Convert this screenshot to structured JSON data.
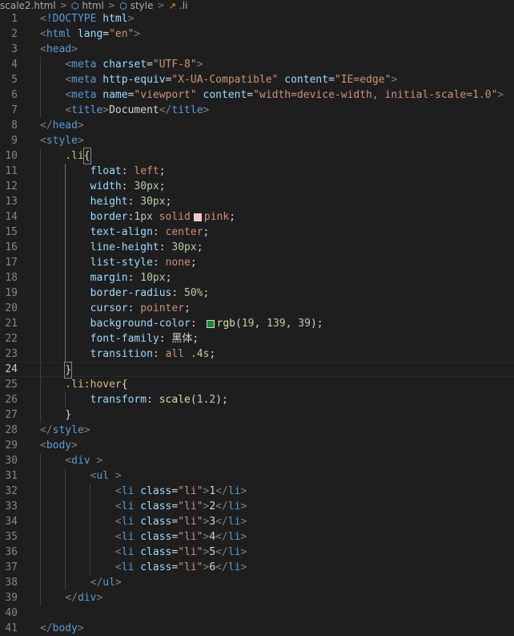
{
  "breadcrumb": {
    "file": "scale2.html",
    "items": [
      "html",
      "style",
      ".li"
    ],
    "icons": [
      "html-file-icon",
      "cube-element-icon",
      "cube-element-icon",
      "selector-symbol-icon"
    ]
  },
  "colors": {
    "background": "#1e1e1e",
    "tag": "#569cd6",
    "attribute": "#9cdcfe",
    "string": "#ce9178",
    "selector": "#d7ba7d",
    "number": "#b5cea8",
    "pink_swatch": "#ffc0cb",
    "green_swatch": "#138b27"
  },
  "editor": {
    "current_line": 24,
    "lines": [
      {
        "n": "1",
        "parts": [
          [
            "br",
            "<"
          ],
          [
            "tag",
            "!DOCTYPE"
          ],
          [
            "txt",
            " "
          ],
          [
            "attr",
            "html"
          ],
          [
            "br",
            ">"
          ]
        ]
      },
      {
        "n": "2",
        "parts": [
          [
            "br",
            "<"
          ],
          [
            "tag",
            "html"
          ],
          [
            "txt",
            " "
          ],
          [
            "attr",
            "lang"
          ],
          [
            "txt",
            "="
          ],
          [
            "str",
            "\"en\""
          ],
          [
            "br",
            ">"
          ]
        ]
      },
      {
        "n": "3",
        "parts": [
          [
            "br",
            "<"
          ],
          [
            "tag",
            "head"
          ],
          [
            "br",
            ">"
          ]
        ]
      },
      {
        "n": "4",
        "parts": [
          [
            "txt",
            "    "
          ],
          [
            "br",
            "<"
          ],
          [
            "tag",
            "meta"
          ],
          [
            "txt",
            " "
          ],
          [
            "attr",
            "charset"
          ],
          [
            "txt",
            "="
          ],
          [
            "str",
            "\"UTF-8\""
          ],
          [
            "br",
            ">"
          ]
        ]
      },
      {
        "n": "5",
        "parts": [
          [
            "txt",
            "    "
          ],
          [
            "br",
            "<"
          ],
          [
            "tag",
            "meta"
          ],
          [
            "txt",
            " "
          ],
          [
            "attr",
            "http-equiv"
          ],
          [
            "txt",
            "="
          ],
          [
            "str",
            "\"X-UA-Compatible\""
          ],
          [
            "txt",
            " "
          ],
          [
            "attr",
            "content"
          ],
          [
            "txt",
            "="
          ],
          [
            "str",
            "\"IE=edge\""
          ],
          [
            "br",
            ">"
          ]
        ]
      },
      {
        "n": "6",
        "parts": [
          [
            "txt",
            "    "
          ],
          [
            "br",
            "<"
          ],
          [
            "tag",
            "meta"
          ],
          [
            "txt",
            " "
          ],
          [
            "attr",
            "name"
          ],
          [
            "txt",
            "="
          ],
          [
            "str",
            "\"viewport\""
          ],
          [
            "txt",
            " "
          ],
          [
            "attr",
            "content"
          ],
          [
            "txt",
            "="
          ],
          [
            "str",
            "\"width=device-width, initial-scale=1.0\""
          ],
          [
            "br",
            ">"
          ]
        ]
      },
      {
        "n": "7",
        "parts": [
          [
            "txt",
            "    "
          ],
          [
            "br",
            "<"
          ],
          [
            "tag",
            "title"
          ],
          [
            "br",
            ">"
          ],
          [
            "txt",
            "Document"
          ],
          [
            "br",
            "</"
          ],
          [
            "tag",
            "title"
          ],
          [
            "br",
            ">"
          ]
        ]
      },
      {
        "n": "8",
        "parts": [
          [
            "br",
            "</"
          ],
          [
            "tag",
            "head"
          ],
          [
            "br",
            ">"
          ]
        ]
      },
      {
        "n": "9",
        "parts": [
          [
            "br",
            "<"
          ],
          [
            "tag",
            "style"
          ],
          [
            "br",
            ">"
          ]
        ]
      },
      {
        "n": "10",
        "parts": [
          [
            "txt",
            "    "
          ],
          [
            "sel",
            ".li"
          ],
          [
            "bracket",
            "{"
          ]
        ]
      },
      {
        "n": "11",
        "parts": [
          [
            "txt",
            "        "
          ],
          [
            "prop",
            "float"
          ],
          [
            "txt",
            ": "
          ],
          [
            "val",
            "left"
          ],
          [
            "txt",
            ";"
          ]
        ]
      },
      {
        "n": "12",
        "parts": [
          [
            "txt",
            "        "
          ],
          [
            "prop",
            "width"
          ],
          [
            "txt",
            ": "
          ],
          [
            "num",
            "30px"
          ],
          [
            "txt",
            ";"
          ]
        ]
      },
      {
        "n": "13",
        "parts": [
          [
            "txt",
            "        "
          ],
          [
            "prop",
            "height"
          ],
          [
            "txt",
            ": "
          ],
          [
            "num",
            "30px"
          ],
          [
            "txt",
            ";"
          ]
        ]
      },
      {
        "n": "14",
        "parts": [
          [
            "txt",
            "        "
          ],
          [
            "prop",
            "border"
          ],
          [
            "txt",
            ":"
          ],
          [
            "num",
            "1px"
          ],
          [
            "txt",
            " "
          ],
          [
            "val",
            "solid"
          ],
          [
            "swatch",
            "#ffc0cb"
          ],
          [
            "val",
            "pink"
          ],
          [
            "txt",
            ";"
          ]
        ]
      },
      {
        "n": "15",
        "parts": [
          [
            "txt",
            "        "
          ],
          [
            "prop",
            "text-align"
          ],
          [
            "txt",
            ": "
          ],
          [
            "val",
            "center"
          ],
          [
            "txt",
            ";"
          ]
        ]
      },
      {
        "n": "16",
        "parts": [
          [
            "txt",
            "        "
          ],
          [
            "prop",
            "line-height"
          ],
          [
            "txt",
            ": "
          ],
          [
            "num",
            "30px"
          ],
          [
            "txt",
            ";"
          ]
        ]
      },
      {
        "n": "17",
        "parts": [
          [
            "txt",
            "        "
          ],
          [
            "prop",
            "list-style"
          ],
          [
            "txt",
            ": "
          ],
          [
            "val",
            "none"
          ],
          [
            "txt",
            ";"
          ]
        ]
      },
      {
        "n": "18",
        "parts": [
          [
            "txt",
            "        "
          ],
          [
            "prop",
            "margin"
          ],
          [
            "txt",
            ": "
          ],
          [
            "num",
            "10px"
          ],
          [
            "txt",
            ";"
          ]
        ]
      },
      {
        "n": "19",
        "parts": [
          [
            "txt",
            "        "
          ],
          [
            "prop",
            "border-radius"
          ],
          [
            "txt",
            ": "
          ],
          [
            "num",
            "50%"
          ],
          [
            "txt",
            ";"
          ]
        ]
      },
      {
        "n": "20",
        "parts": [
          [
            "txt",
            "        "
          ],
          [
            "prop",
            "cursor"
          ],
          [
            "txt",
            ": "
          ],
          [
            "val",
            "pointer"
          ],
          [
            "txt",
            ";"
          ]
        ]
      },
      {
        "n": "21",
        "parts": [
          [
            "txt",
            "        "
          ],
          [
            "prop",
            "background-color"
          ],
          [
            "txt",
            ": "
          ],
          [
            "swatch",
            "#138b27"
          ],
          [
            "fn",
            "rgb"
          ],
          [
            "txt",
            "("
          ],
          [
            "num",
            "19"
          ],
          [
            "txt",
            ", "
          ],
          [
            "num",
            "139"
          ],
          [
            "txt",
            ", "
          ],
          [
            "num",
            "39"
          ],
          [
            "txt",
            ");"
          ]
        ]
      },
      {
        "n": "22",
        "parts": [
          [
            "txt",
            "        "
          ],
          [
            "prop",
            "font-family"
          ],
          [
            "txt",
            ": "
          ],
          [
            "txt",
            "黑体"
          ],
          [
            "txt",
            ";"
          ]
        ]
      },
      {
        "n": "23",
        "parts": [
          [
            "txt",
            "        "
          ],
          [
            "prop",
            "transition"
          ],
          [
            "txt",
            ": "
          ],
          [
            "val",
            "all"
          ],
          [
            "txt",
            " "
          ],
          [
            "num",
            ".4s"
          ],
          [
            "txt",
            ";"
          ]
        ]
      },
      {
        "n": "24",
        "parts": [
          [
            "txt",
            "    "
          ],
          [
            "bracket",
            "}"
          ]
        ]
      },
      {
        "n": "25",
        "parts": [
          [
            "txt",
            "    "
          ],
          [
            "sel",
            ".li:hover"
          ],
          [
            "txt",
            "{"
          ]
        ]
      },
      {
        "n": "26",
        "parts": [
          [
            "txt",
            "        "
          ],
          [
            "prop",
            "transform"
          ],
          [
            "txt",
            ": "
          ],
          [
            "fn",
            "scale"
          ],
          [
            "txt",
            "("
          ],
          [
            "num",
            "1.2"
          ],
          [
            "txt",
            ");"
          ]
        ]
      },
      {
        "n": "27",
        "parts": [
          [
            "txt",
            "    "
          ],
          [
            "txt",
            "}"
          ]
        ]
      },
      {
        "n": "28",
        "parts": [
          [
            "br",
            "</"
          ],
          [
            "tag",
            "style"
          ],
          [
            "br",
            ">"
          ]
        ]
      },
      {
        "n": "29",
        "parts": [
          [
            "br",
            "<"
          ],
          [
            "tag",
            "body"
          ],
          [
            "br",
            ">"
          ]
        ]
      },
      {
        "n": "30",
        "parts": [
          [
            "txt",
            "    "
          ],
          [
            "br",
            "<"
          ],
          [
            "tag",
            "div"
          ],
          [
            "txt",
            " "
          ],
          [
            "br",
            ">"
          ]
        ]
      },
      {
        "n": "31",
        "parts": [
          [
            "txt",
            "        "
          ],
          [
            "br",
            "<"
          ],
          [
            "tag",
            "ul"
          ],
          [
            "txt",
            " "
          ],
          [
            "br",
            ">"
          ]
        ]
      },
      {
        "n": "32",
        "parts": [
          [
            "txt",
            "            "
          ],
          [
            "br",
            "<"
          ],
          [
            "tag",
            "li"
          ],
          [
            "txt",
            " "
          ],
          [
            "attr",
            "class"
          ],
          [
            "txt",
            "="
          ],
          [
            "str",
            "\"li\""
          ],
          [
            "br",
            ">"
          ],
          [
            "txt",
            "1"
          ],
          [
            "br",
            "</"
          ],
          [
            "tag",
            "li"
          ],
          [
            "br",
            ">"
          ]
        ]
      },
      {
        "n": "33",
        "parts": [
          [
            "txt",
            "            "
          ],
          [
            "br",
            "<"
          ],
          [
            "tag",
            "li"
          ],
          [
            "txt",
            " "
          ],
          [
            "attr",
            "class"
          ],
          [
            "txt",
            "="
          ],
          [
            "str",
            "\"li\""
          ],
          [
            "br",
            ">"
          ],
          [
            "txt",
            "2"
          ],
          [
            "br",
            "</"
          ],
          [
            "tag",
            "li"
          ],
          [
            "br",
            ">"
          ]
        ]
      },
      {
        "n": "34",
        "parts": [
          [
            "txt",
            "            "
          ],
          [
            "br",
            "<"
          ],
          [
            "tag",
            "li"
          ],
          [
            "txt",
            " "
          ],
          [
            "attr",
            "class"
          ],
          [
            "txt",
            "="
          ],
          [
            "str",
            "\"li\""
          ],
          [
            "br",
            ">"
          ],
          [
            "txt",
            "3"
          ],
          [
            "br",
            "</"
          ],
          [
            "tag",
            "li"
          ],
          [
            "br",
            ">"
          ]
        ]
      },
      {
        "n": "35",
        "parts": [
          [
            "txt",
            "            "
          ],
          [
            "br",
            "<"
          ],
          [
            "tag",
            "li"
          ],
          [
            "txt",
            " "
          ],
          [
            "attr",
            "class"
          ],
          [
            "txt",
            "="
          ],
          [
            "str",
            "\"li\""
          ],
          [
            "br",
            ">"
          ],
          [
            "txt",
            "4"
          ],
          [
            "br",
            "</"
          ],
          [
            "tag",
            "li"
          ],
          [
            "br",
            ">"
          ]
        ]
      },
      {
        "n": "36",
        "parts": [
          [
            "txt",
            "            "
          ],
          [
            "br",
            "<"
          ],
          [
            "tag",
            "li"
          ],
          [
            "txt",
            " "
          ],
          [
            "attr",
            "class"
          ],
          [
            "txt",
            "="
          ],
          [
            "str",
            "\"li\""
          ],
          [
            "br",
            ">"
          ],
          [
            "txt",
            "5"
          ],
          [
            "br",
            "</"
          ],
          [
            "tag",
            "li"
          ],
          [
            "br",
            ">"
          ]
        ]
      },
      {
        "n": "37",
        "parts": [
          [
            "txt",
            "            "
          ],
          [
            "br",
            "<"
          ],
          [
            "tag",
            "li"
          ],
          [
            "txt",
            " "
          ],
          [
            "attr",
            "class"
          ],
          [
            "txt",
            "="
          ],
          [
            "str",
            "\"li\""
          ],
          [
            "br",
            ">"
          ],
          [
            "txt",
            "6"
          ],
          [
            "br",
            "</"
          ],
          [
            "tag",
            "li"
          ],
          [
            "br",
            ">"
          ]
        ]
      },
      {
        "n": "38",
        "parts": [
          [
            "txt",
            "        "
          ],
          [
            "br",
            "</"
          ],
          [
            "tag",
            "ul"
          ],
          [
            "br",
            ">"
          ]
        ]
      },
      {
        "n": "39",
        "parts": [
          [
            "txt",
            "    "
          ],
          [
            "br",
            "</"
          ],
          [
            "tag",
            "div"
          ],
          [
            "br",
            ">"
          ]
        ]
      },
      {
        "n": "40",
        "parts": []
      },
      {
        "n": "41",
        "parts": [
          [
            "br",
            "</"
          ],
          [
            "tag",
            "body"
          ],
          [
            "br",
            ">"
          ]
        ]
      }
    ]
  }
}
